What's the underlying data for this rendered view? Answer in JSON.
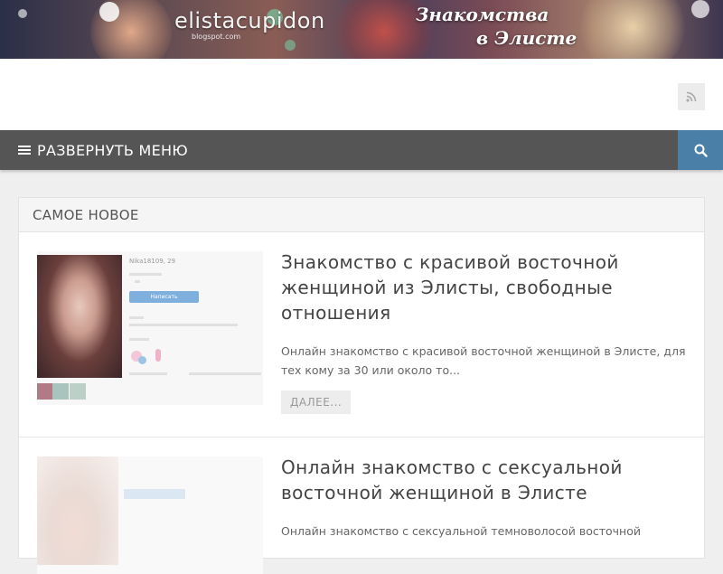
{
  "header": {
    "site_title": "elistacupidon",
    "site_subtitle": "blogspot.com",
    "tagline_line1": "Знакомства",
    "tagline_line2": "в Элисте"
  },
  "nav": {
    "menu_label": "РАЗВЕРНУТЬ МЕНЮ",
    "rss_icon": "rss-icon",
    "search_icon": "search-icon",
    "accent_color": "#4a7fa7",
    "bar_color": "#555555"
  },
  "section": {
    "title": "САМОЕ НОВОЕ"
  },
  "posts": [
    {
      "title": "Знакомство с красивой восточной женщиной из Элисты, свободные отношения",
      "excerpt": "Онлайн знакомство с красивой восточной женщиной в Элисте, для тех кому за 30 или около то...",
      "more_label": "ДАЛЕЕ...",
      "thumb_username": "Nika18109, 29",
      "thumb_button": "Написать"
    },
    {
      "title": "Онлайн знакомство с сексуальной восточной женщиной в Элисте",
      "excerpt": "Онлайн знакомство с сексуальной темноволосой восточной"
    }
  ]
}
